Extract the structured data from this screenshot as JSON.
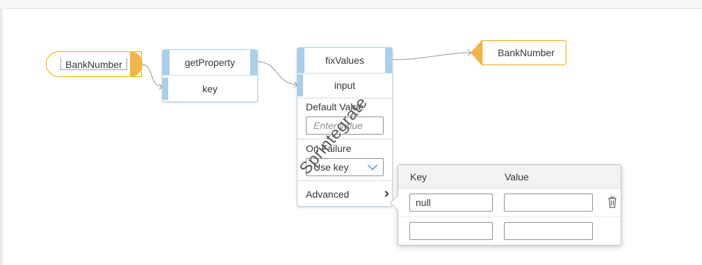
{
  "canvas": {
    "source_node": {
      "label": "BankNumber"
    },
    "get_property_node": {
      "title": "getProperty",
      "port": "key"
    },
    "fix_values_node": {
      "title": "fixValues",
      "port": "input",
      "default_value": {
        "label": "Default Value",
        "placeholder": "Enter value"
      },
      "on_failure": {
        "label": "On Failure",
        "selected": "Use key"
      },
      "advanced_label": "Advanced"
    },
    "target_node": {
      "label": "BankNumber"
    },
    "watermark": "Sprintegrate"
  },
  "popover": {
    "columns": {
      "key": "Key",
      "value": "Value"
    },
    "rows": [
      {
        "key": "null",
        "value": ""
      },
      {
        "key": "",
        "value": ""
      }
    ]
  },
  "icons": {
    "advanced": "double-chevron-right-icon",
    "dropdown": "chevron-down-icon",
    "delete": "trash-icon"
  },
  "colors": {
    "accent_orange": "#f0ab00",
    "node_blue": "#a9cfe9",
    "link_blue": "#0a6ed1"
  }
}
